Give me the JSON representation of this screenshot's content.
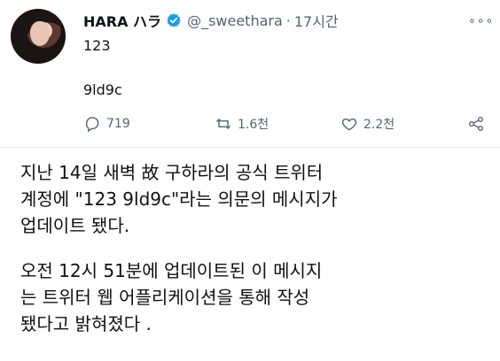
{
  "tweet": {
    "display_name": "HARA ハラ",
    "handle": "@_sweethara",
    "dot": "·",
    "time": "17시간",
    "more_label": "∘∘∘",
    "text_line1": "123",
    "text_line2": "9ld9c",
    "actions": {
      "reply_count": "719",
      "retweet_count": "1.6천",
      "like_count": "2.2천"
    }
  },
  "article": {
    "paragraph1_lines": [
      "지난 14일 새벽 故 구하라의 공식 트위터",
      "계정에 \"123 9ld9c\"라는 의문의 메시지가",
      "업데이트 됐다."
    ],
    "paragraph2_lines": [
      "오전 12시 51분에 업데이트된 이 메시지",
      "는 트위터 웹 어플리케이션을 통해 작성",
      "됐다고 밝혀졌다 ."
    ]
  },
  "icons": {
    "verified": "verified-badge-icon",
    "reply": "reply-icon",
    "retweet": "retweet-icon",
    "like": "heart-icon",
    "share": "share-icon",
    "more": "more-icon"
  },
  "colors": {
    "verified": "#1d9bf0",
    "muted": "#536471",
    "text": "#0f1419"
  }
}
